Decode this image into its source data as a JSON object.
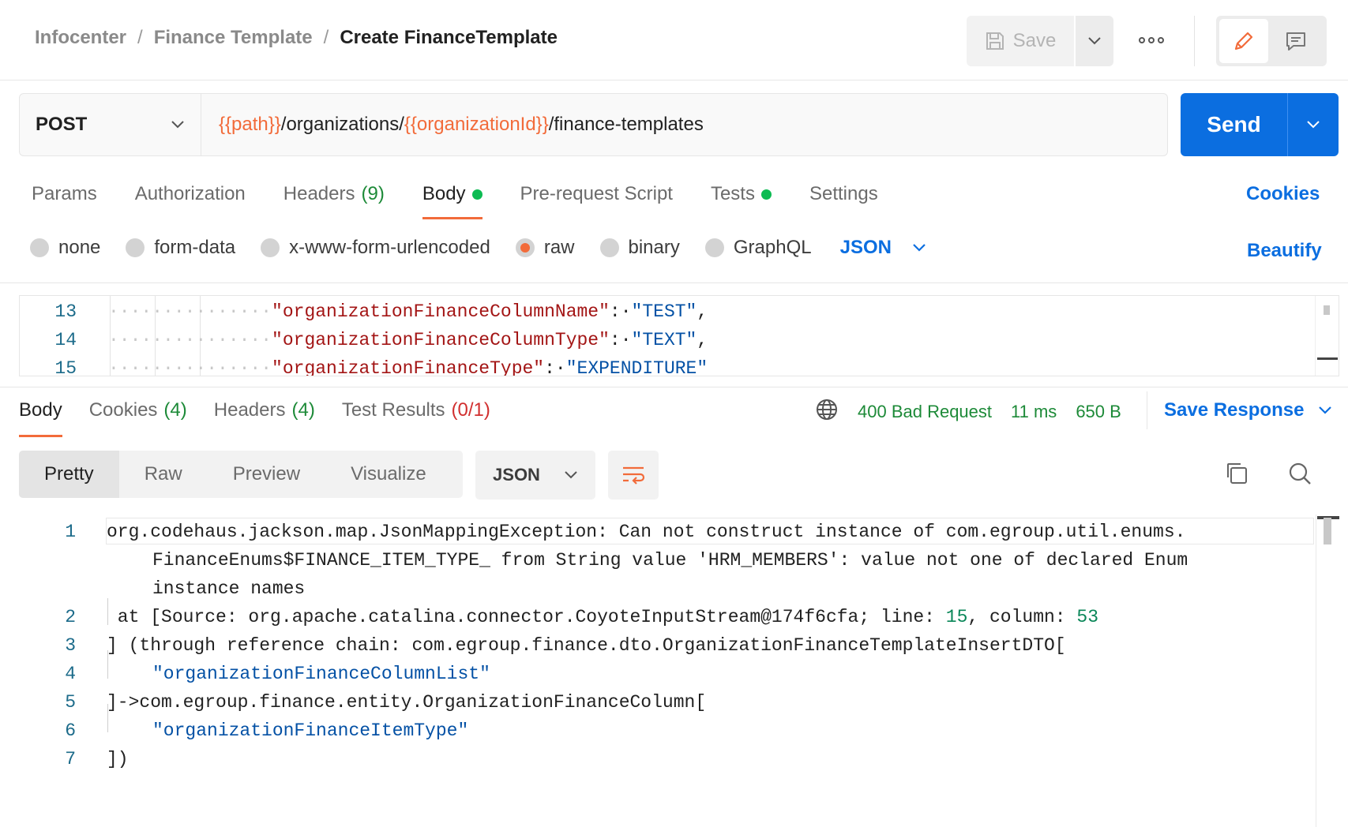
{
  "breadcrumb": {
    "items": [
      "Infocenter",
      "Finance Template"
    ],
    "separator": "/",
    "current": "Create FinanceTemplate"
  },
  "toolbar": {
    "save_label": "Save",
    "more_icon": "ellipsis-icon",
    "edit_icon": "pencil-icon",
    "comments_icon": "comment-icon"
  },
  "request": {
    "method": "POST",
    "url_parts": [
      {
        "text": "{{path}}",
        "type": "var"
      },
      {
        "text": "/organizations/",
        "type": "text"
      },
      {
        "text": "{{organizationId}}",
        "type": "var"
      },
      {
        "text": "/finance-templates",
        "type": "text"
      }
    ],
    "send_label": "Send"
  },
  "request_tabs": [
    {
      "label": "Params",
      "count": "",
      "dot": false,
      "active": false
    },
    {
      "label": "Authorization",
      "count": "",
      "dot": false,
      "active": false
    },
    {
      "label": "Headers",
      "count": "(9)",
      "dot": false,
      "active": false
    },
    {
      "label": "Body",
      "count": "",
      "dot": true,
      "active": true
    },
    {
      "label": "Pre-request Script",
      "count": "",
      "dot": false,
      "active": false
    },
    {
      "label": "Tests",
      "count": "",
      "dot": true,
      "active": false
    },
    {
      "label": "Settings",
      "count": "",
      "dot": false,
      "active": false
    }
  ],
  "cookies_label": "Cookies",
  "body_types": [
    {
      "label": "none",
      "checked": false
    },
    {
      "label": "form-data",
      "checked": false
    },
    {
      "label": "x-www-form-urlencoded",
      "checked": false
    },
    {
      "label": "raw",
      "checked": true
    },
    {
      "label": "binary",
      "checked": false
    },
    {
      "label": "GraphQL",
      "checked": false
    }
  ],
  "body_language": "JSON",
  "beautify_label": "Beautify",
  "request_body": [
    {
      "line": "13",
      "key": "\"organizationFinanceColumnName\"",
      "value": "\"TEST\""
    },
    {
      "line": "14",
      "key": "\"organizationFinanceColumnType\"",
      "value": "\"TEXT\""
    },
    {
      "line": "15",
      "key": "\"organizationFinanceType\"",
      "value": "\"EXPENDITURE\""
    }
  ],
  "response_tabs": [
    {
      "label": "Body",
      "count": "",
      "count_color": "",
      "active": true
    },
    {
      "label": "Cookies",
      "count": "(4)",
      "count_color": "green",
      "active": false
    },
    {
      "label": "Headers",
      "count": "(4)",
      "count_color": "green",
      "active": false
    },
    {
      "label": "Test Results",
      "count": "(0/1)",
      "count_color": "red",
      "active": false
    }
  ],
  "response_meta": {
    "status": "400 Bad Request",
    "time": "11 ms",
    "size": "650 B",
    "globe_icon": "globe-icon"
  },
  "save_response_label": "Save Response",
  "view_modes": [
    "Pretty",
    "Raw",
    "Preview",
    "Visualize"
  ],
  "active_view": "Pretty",
  "response_format": "JSON",
  "response_body": {
    "line1_a": "org.codehaus.jackson.map.JsonMappingException: Can not construct instance of com.egroup.util.enums.",
    "line1_b": "FinanceEnums$FINANCE_ITEM_TYPE_ from String value 'HRM_MEMBERS': value not one of declared Enum",
    "line1_c": "instance names",
    "line2_a": " at [Source: org.apache.catalina.connector.CoyoteInputStream@174f6cfa; line: ",
    "line2_line": "15",
    "line2_b": ", column: ",
    "line2_col": "53",
    "line3": "] (through reference chain: com.egroup.finance.dto.OrganizationFinanceTemplateInsertDTO[",
    "line4": "\"organizationFinanceColumnList\"",
    "line5": "]->com.egroup.finance.entity.OrganizationFinanceColumn[",
    "line6": "\"organizationFinanceItemType\"",
    "line7": "])",
    "line_numbers": [
      "1",
      "2",
      "3",
      "4",
      "5",
      "6",
      "7"
    ]
  },
  "colors": {
    "accent": "#f26b3a",
    "brand_blue": "#0b6ee0",
    "success_green": "#1d8a38"
  }
}
